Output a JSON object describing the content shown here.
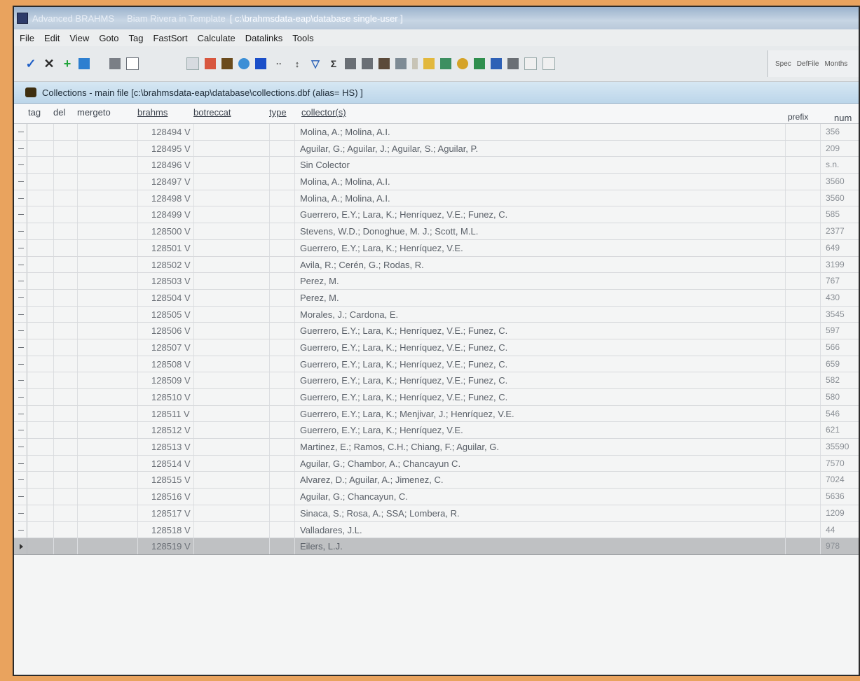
{
  "window": {
    "title_part1": "Advanced BRAHMS",
    "title_part2": "Biam Rivera in Template",
    "title_part3": "[ c:\\brahmsdata-eap\\database  single-user ]"
  },
  "menu": [
    "File",
    "Edit",
    "View",
    "Goto",
    "Tag",
    "FastSort",
    "Calculate",
    "Datalinks",
    "Tools"
  ],
  "toolbar": {
    "right_labels": [
      "Spec",
      "DefFile",
      "Months"
    ]
  },
  "child_window": {
    "title": "Collections - main file [c:\\brahmsdata-eap\\database\\collections.dbf (alias= HS) ]"
  },
  "grid": {
    "headers": {
      "tag": "tag",
      "del": "del",
      "mergeto": "mergeto",
      "brahms": "brahms",
      "botreccat": "botreccat",
      "type": "type",
      "collectors": "collector(s)",
      "prefix": "prefix",
      "number": "num"
    },
    "rows": [
      {
        "brahms": "128494 V",
        "collectors": "Molina, A.; Molina, A.I.",
        "number": "356"
      },
      {
        "brahms": "128495 V",
        "collectors": "Aguilar, G.; Aguilar, J.; Aguilar, S.; Aguilar, P.",
        "number": "209"
      },
      {
        "brahms": "128496 V",
        "collectors": "Sin Colector",
        "number": "s.n."
      },
      {
        "brahms": "128497 V",
        "collectors": "Molina, A.; Molina, A.I.",
        "number": "3560"
      },
      {
        "brahms": "128498 V",
        "collectors": "Molina, A.; Molina, A.I.",
        "number": "3560"
      },
      {
        "brahms": "128499 V",
        "collectors": "Guerrero, E.Y.; Lara, K.; Henríquez, V.E.; Funez, C.",
        "number": "585"
      },
      {
        "brahms": "128500 V",
        "collectors": "Stevens, W.D.; Donoghue, M. J.; Scott, M.L.",
        "number": "2377"
      },
      {
        "brahms": "128501 V",
        "collectors": "Guerrero, E.Y.; Lara, K.; Henríquez, V.E.",
        "number": "649"
      },
      {
        "brahms": "128502 V",
        "collectors": "Avila, R.; Cerén, G.; Rodas, R.",
        "number": "3199"
      },
      {
        "brahms": "128503 V",
        "collectors": "Perez, M.",
        "number": "767"
      },
      {
        "brahms": "128504 V",
        "collectors": "Perez, M.",
        "number": "430"
      },
      {
        "brahms": "128505 V",
        "collectors": "Morales, J.; Cardona, E.",
        "number": "3545"
      },
      {
        "brahms": "128506 V",
        "collectors": "Guerrero, E.Y.; Lara, K.; Henríquez, V.E.; Funez, C.",
        "number": "597"
      },
      {
        "brahms": "128507 V",
        "collectors": "Guerrero, E.Y.; Lara, K.; Henríquez, V.E.; Funez, C.",
        "number": "566"
      },
      {
        "brahms": "128508 V",
        "collectors": "Guerrero, E.Y.; Lara, K.; Henríquez, V.E.; Funez, C.",
        "number": "659"
      },
      {
        "brahms": "128509 V",
        "collectors": "Guerrero, E.Y.; Lara, K.; Henríquez, V.E.; Funez, C.",
        "number": "582"
      },
      {
        "brahms": "128510 V",
        "collectors": "Guerrero, E.Y.; Lara, K.; Henríquez, V.E.; Funez, C.",
        "number": "580"
      },
      {
        "brahms": "128511 V",
        "collectors": "Guerrero, E.Y.; Lara, K.; Menjivar, J.; Henríquez, V.E.",
        "number": "546"
      },
      {
        "brahms": "128512 V",
        "collectors": "Guerrero, E.Y.; Lara, K.; Henríquez, V.E.",
        "number": "621"
      },
      {
        "brahms": "128513 V",
        "collectors": "Martinez, E.; Ramos, C.H.; Chiang, F.; Aguilar, G.",
        "number": "35590"
      },
      {
        "brahms": "128514 V",
        "collectors": "Aguilar, G.; Chambor, A.; Chancayun C.",
        "number": "7570"
      },
      {
        "brahms": "128515 V",
        "collectors": "Alvarez, D.; Aguilar, A.; Jimenez, C.",
        "number": "7024"
      },
      {
        "brahms": "128516 V",
        "collectors": "Aguilar, G.; Chancayun, C.",
        "number": "5636"
      },
      {
        "brahms": "128517 V",
        "collectors": "Sinaca, S.; Rosa, A.; SSA; Lombera, R.",
        "number": "1209"
      },
      {
        "brahms": "128518 V",
        "collectors": "Valladares, J.L.",
        "number": "44"
      },
      {
        "brahms": "128519 V",
        "collectors": "Eilers, L.J.",
        "number": "978",
        "selected": true
      }
    ]
  }
}
